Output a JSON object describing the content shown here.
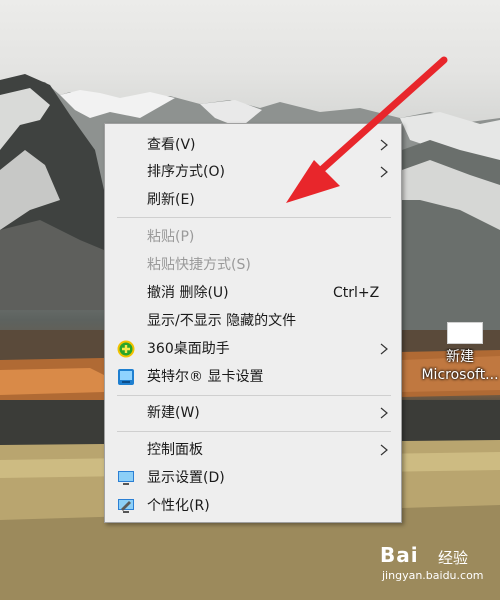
{
  "desktop_icon": {
    "label_line1": "新建",
    "label_line2": "Microsoft..."
  },
  "context_menu": {
    "items": [
      {
        "label": "查看(V)"
      },
      {
        "label": "排序方式(O)"
      },
      {
        "label": "刷新(E)"
      },
      {
        "label": "粘贴(P)"
      },
      {
        "label": "粘贴快捷方式(S)"
      },
      {
        "label": "撤消 删除(U)",
        "shortcut": "Ctrl+Z"
      },
      {
        "label": "显示/不显示 隐藏的文件"
      },
      {
        "label": "360桌面助手"
      },
      {
        "label": "英特尔® 显卡设置"
      },
      {
        "label": "新建(W)"
      },
      {
        "label": "控制面板"
      },
      {
        "label": "显示设置(D)"
      },
      {
        "label": "个性化(R)"
      }
    ]
  },
  "watermark": {
    "brand": "Bai",
    "cn": "经验",
    "url": "jingyan.baidu.com"
  },
  "colors": {
    "menu_bg": "#eeeeee",
    "disabled_text": "#9a9a9a",
    "arrow_red": "#e8262b",
    "icon_360_green": "#2aa52a"
  }
}
